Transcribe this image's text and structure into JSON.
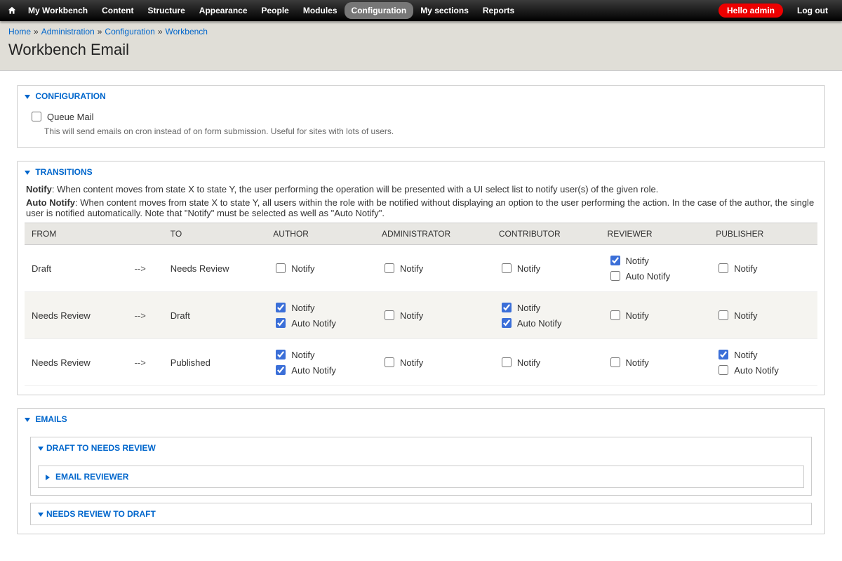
{
  "toolbar": {
    "items": [
      "My Workbench",
      "Content",
      "Structure",
      "Appearance",
      "People",
      "Modules",
      "Configuration",
      "My sections",
      "Reports"
    ],
    "active_index": 6,
    "hello": "Hello admin",
    "logout": "Log out"
  },
  "breadcrumb": {
    "items": [
      "Home",
      "Administration",
      "Configuration",
      "Workbench"
    ]
  },
  "page_title": "Workbench Email",
  "config_section": {
    "legend": "Configuration",
    "queue_label": "Queue Mail",
    "queue_desc": "This will send emails on cron instead of on form submission. Useful for sites with lots of users."
  },
  "transitions_section": {
    "legend": "Transitions",
    "notify_help_label": "Notify",
    "notify_help": ": When content moves from state X to state Y, the user performing the operation will be presented with a UI select list to notify user(s) of the given role.",
    "auto_help_label": "Auto Notify",
    "auto_help": ": When content moves from state X to state Y, all users within the role with be notified without displaying an option to the user performing the action. In the case of the author, the single user is notified automatically. Note that \"Notify\" must be selected as well as \"Auto Notify\".",
    "columns": [
      "FROM",
      "",
      "TO",
      "AUTHOR",
      "ADMINISTRATOR",
      "CONTRIBUTOR",
      "REVIEWER",
      "PUBLISHER"
    ],
    "arrow": "-->",
    "labels": {
      "notify": "Notify",
      "auto": "Auto Notify"
    },
    "rows": [
      {
        "from": "Draft",
        "to": "Needs Review",
        "author": {
          "notify": false,
          "notify_checked": false,
          "auto": false,
          "auto_checked": false
        },
        "administrator": {
          "notify": false,
          "notify_checked": false,
          "auto": false,
          "auto_checked": false
        },
        "contributor": {
          "notify": false,
          "notify_checked": false,
          "auto": false,
          "auto_checked": false
        },
        "reviewer": {
          "notify": true,
          "notify_checked": true,
          "auto": true,
          "auto_checked": false
        },
        "publisher": {
          "notify": false,
          "notify_checked": false,
          "auto": false,
          "auto_checked": false
        }
      },
      {
        "from": "Needs Review",
        "to": "Draft",
        "author": {
          "notify": true,
          "notify_checked": true,
          "auto": true,
          "auto_checked": true
        },
        "administrator": {
          "notify": false,
          "notify_checked": false,
          "auto": false,
          "auto_checked": false
        },
        "contributor": {
          "notify": true,
          "notify_checked": true,
          "auto": true,
          "auto_checked": true
        },
        "reviewer": {
          "notify": false,
          "notify_checked": false,
          "auto": false,
          "auto_checked": false
        },
        "publisher": {
          "notify": false,
          "notify_checked": false,
          "auto": false,
          "auto_checked": false
        }
      },
      {
        "from": "Needs Review",
        "to": "Published",
        "author": {
          "notify": true,
          "notify_checked": true,
          "auto": true,
          "auto_checked": true
        },
        "administrator": {
          "notify": false,
          "notify_checked": false,
          "auto": false,
          "auto_checked": false
        },
        "contributor": {
          "notify": false,
          "notify_checked": false,
          "auto": false,
          "auto_checked": false
        },
        "reviewer": {
          "notify": false,
          "notify_checked": false,
          "auto": false,
          "auto_checked": false
        },
        "publisher": {
          "notify": true,
          "notify_checked": true,
          "auto": true,
          "auto_checked": false
        }
      }
    ]
  },
  "emails_section": {
    "legend": "Emails",
    "subsections": [
      {
        "legend": "Draft to Needs Review",
        "children": [
          {
            "legend": "Email Reviewer",
            "collapsed": true
          }
        ]
      },
      {
        "legend": "Needs Review to Draft",
        "children": []
      }
    ]
  }
}
